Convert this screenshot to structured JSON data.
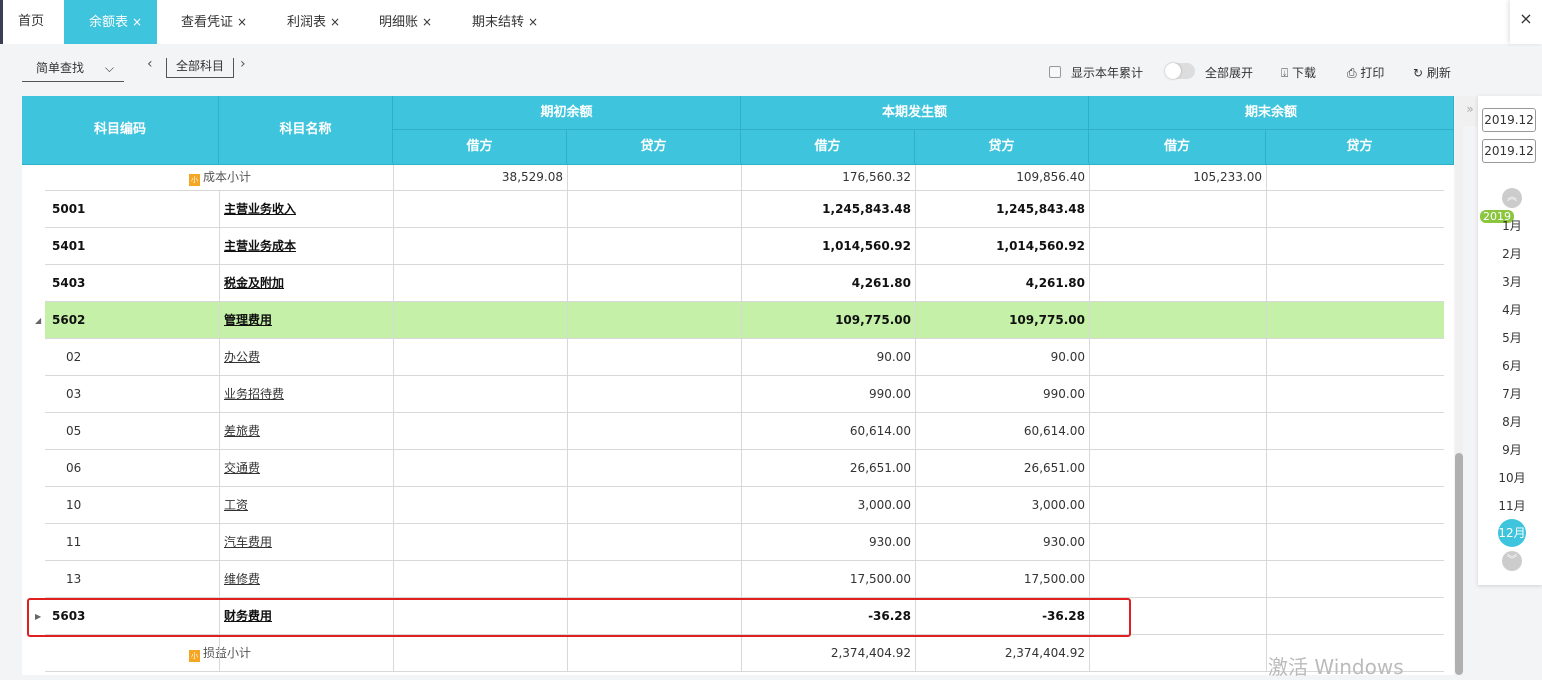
{
  "tabs": [
    {
      "label": "首页"
    },
    {
      "label": "余额表",
      "active": true
    },
    {
      "label": "查看凭证"
    },
    {
      "label": "利润表"
    },
    {
      "label": "明细账"
    },
    {
      "label": "期末结转"
    }
  ],
  "close_all": "×",
  "tab_close": "×",
  "toolbar": {
    "search_mode": "简单查找",
    "all_subjects": "全部科目",
    "prev": "‹",
    "next": "›",
    "show_ytd": "显示本年累计",
    "expand_all": "全部展开",
    "download": "下载",
    "print": "打印",
    "refresh": "刷新"
  },
  "columns": {
    "code": "科目编码",
    "name": "科目名称",
    "opening": "期初余额",
    "current": "本期发生额",
    "closing": "期末余额",
    "debit": "借方",
    "credit": "贷方"
  },
  "rows": [
    {
      "code": "",
      "name": "成本小计",
      "subtotal": true,
      "v": [
        "38,529.08",
        "",
        "176,560.32",
        "109,856.40",
        "105,233.00",
        ""
      ]
    },
    {
      "code": "5001",
      "name": "主营业务收入",
      "bold": true,
      "v": [
        "",
        "",
        "1,245,843.48",
        "1,245,843.48",
        "",
        ""
      ]
    },
    {
      "code": "5401",
      "name": "主营业务成本",
      "bold": true,
      "v": [
        "",
        "",
        "1,014,560.92",
        "1,014,560.92",
        "",
        ""
      ]
    },
    {
      "code": "5403",
      "name": "税金及附加",
      "bold": true,
      "v": [
        "",
        "",
        "4,261.80",
        "4,261.80",
        "",
        ""
      ]
    },
    {
      "code": "5602",
      "name": "管理费用",
      "bold": true,
      "green": true,
      "expanded": true,
      "v": [
        "",
        "",
        "109,775.00",
        "109,775.00",
        "",
        ""
      ]
    },
    {
      "code": "02",
      "name": "办公费",
      "v": [
        "",
        "",
        "90.00",
        "90.00",
        "",
        ""
      ]
    },
    {
      "code": "03",
      "name": "业务招待费",
      "v": [
        "",
        "",
        "990.00",
        "990.00",
        "",
        ""
      ]
    },
    {
      "code": "05",
      "name": "差旅费",
      "v": [
        "",
        "",
        "60,614.00",
        "60,614.00",
        "",
        ""
      ]
    },
    {
      "code": "06",
      "name": "交通费",
      "v": [
        "",
        "",
        "26,651.00",
        "26,651.00",
        "",
        ""
      ]
    },
    {
      "code": "10",
      "name": "工资",
      "v": [
        "",
        "",
        "3,000.00",
        "3,000.00",
        "",
        ""
      ]
    },
    {
      "code": "11",
      "name": "汽车费用",
      "v": [
        "",
        "",
        "930.00",
        "930.00",
        "",
        ""
      ]
    },
    {
      "code": "13",
      "name": "维修费",
      "v": [
        "",
        "",
        "17,500.00",
        "17,500.00",
        "",
        ""
      ]
    },
    {
      "code": "5603",
      "name": "财务费用",
      "bold": true,
      "collapsed": true,
      "v": [
        "",
        "",
        "-36.28",
        "-36.28",
        "",
        ""
      ]
    },
    {
      "code": "",
      "name": "损益小计",
      "subtotal": true,
      "v": [
        "",
        "",
        "2,374,404.92",
        "2,374,404.92",
        "",
        ""
      ]
    }
  ],
  "badge_text": "小",
  "period": {
    "start": "2019.12",
    "end": "2019.12",
    "year": "2019",
    "months": [
      "1月",
      "2月",
      "3月",
      "4月",
      "5月",
      "6月",
      "7月",
      "8月",
      "9月",
      "10月",
      "11月",
      "12月"
    ],
    "selected": "12月"
  },
  "os_notice": "激活 Windows",
  "colors": {
    "accent": "#3ec4dc",
    "highlight_row": "#c4f0a7",
    "annotation": "#e02020"
  }
}
